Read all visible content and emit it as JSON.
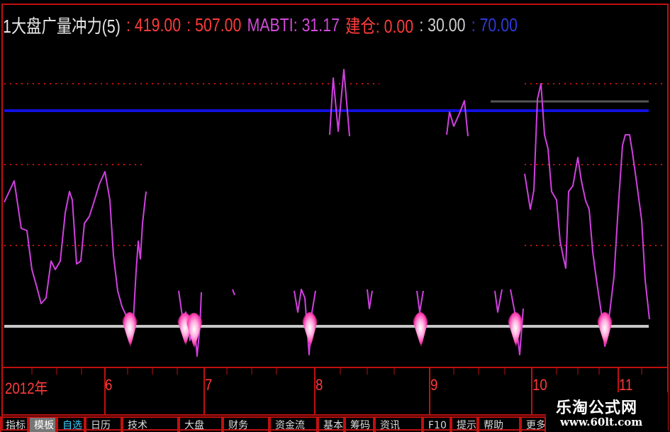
{
  "header": {
    "title": "1大盘广量冲力(5)",
    "v1": ": 419.00",
    "v2": ": 507.00",
    "mabti": "MABTI: 31.17",
    "jiancang": "建仓: 0.00",
    "v30": ": 30.00",
    "v70": ": 70.00"
  },
  "x_axis_labels": [
    "2012年",
    "6",
    "7",
    "8",
    "9",
    "10",
    "11"
  ],
  "watermark": {
    "name": "乐淘公式网",
    "url": "www.60lt.com"
  },
  "tabs": [
    "指标",
    "模板",
    "自选",
    "日历",
    "技术",
    "大盘",
    "财务",
    "资金流",
    "基本面",
    "筹码",
    "资讯",
    "F10",
    "提示",
    "帮助",
    "更多"
  ],
  "colors": {
    "line": "#d040e0",
    "level_high": "#1010e0",
    "level_low": "#c8c8c8",
    "dotted": "#c01010",
    "axis": "#c01010",
    "marker": "#ff60b0"
  },
  "levels": {
    "high": 70,
    "low": 30
  }
}
